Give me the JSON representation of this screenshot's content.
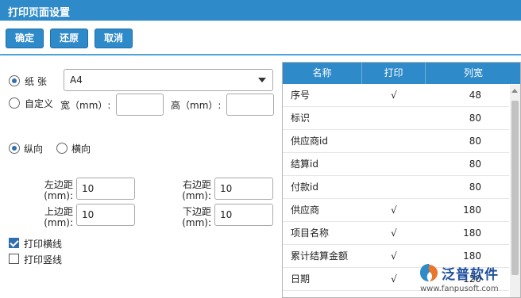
{
  "window": {
    "title": "打印页面设置"
  },
  "toolbar": {
    "confirm": "确定",
    "restore": "还原",
    "cancel": "取消"
  },
  "paper": {
    "paper_label": "纸 张",
    "paper_value": "A4",
    "custom_label": "自定义",
    "width_label": "宽（mm）:",
    "height_label": "高（mm）:",
    "width_value": "",
    "height_value": ""
  },
  "orientation": {
    "portrait": "纵向",
    "landscape": "横向"
  },
  "margins": {
    "left_label_1": "左边距",
    "left_label_2": "(mm):",
    "left_value": "10",
    "right_label_1": "右边距",
    "right_label_2": "(mm):",
    "right_value": "10",
    "top_label_1": "上边距",
    "top_label_2": "(mm):",
    "top_value": "10",
    "bottom_label_1": "下边距",
    "bottom_label_2": "(mm):",
    "bottom_value": "10"
  },
  "options": {
    "print_hlines": "打印横线",
    "print_vlines": "打印竖线"
  },
  "grid": {
    "headers": [
      "名称",
      "打印",
      "列宽"
    ],
    "rows": [
      {
        "name": "序号",
        "print": "√",
        "width": "48"
      },
      {
        "name": "标识",
        "print": "",
        "width": "80"
      },
      {
        "name": "供应商id",
        "print": "",
        "width": "80"
      },
      {
        "name": "结算id",
        "print": "",
        "width": "80"
      },
      {
        "name": "付款id",
        "print": "",
        "width": "80"
      },
      {
        "name": "供应商",
        "print": "√",
        "width": "180"
      },
      {
        "name": "项目名称",
        "print": "√",
        "width": "180"
      },
      {
        "name": "累计结算金额",
        "print": "√",
        "width": "180"
      },
      {
        "name": "日期",
        "print": "√",
        "width": "120"
      }
    ]
  },
  "logo": {
    "text": "泛普软件",
    "url": "www.fanpusoft.com"
  },
  "colors": {
    "accent": "#2f8ac9",
    "logo": "#1d4f9c"
  }
}
